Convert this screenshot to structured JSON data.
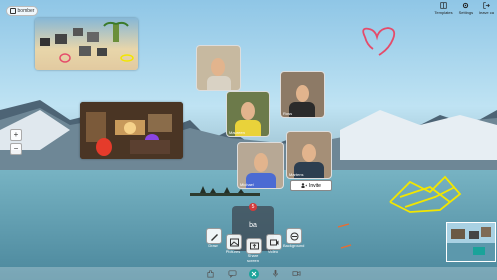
{
  "app": {
    "badge_label": "bomber",
    "badge_icon": "room-icon"
  },
  "toolbar": {
    "items": [
      {
        "label": "Templates",
        "icon": "templates-icon"
      },
      {
        "label": "Settings",
        "icon": "gear-icon"
      },
      {
        "label": "leave ca",
        "icon": "leave-icon"
      }
    ]
  },
  "participants": [
    {
      "name": "",
      "shirt": "#d9d2c4"
    },
    {
      "name": "Maureen",
      "shirt": "#e9d23a"
    },
    {
      "name": "Ross",
      "shirt": "#2b2b2b"
    },
    {
      "name": "Michael",
      "shirt": "#4b6bd3"
    },
    {
      "name": "Martens",
      "shirt": "#2c3e50"
    }
  ],
  "invite": {
    "label": "Invite",
    "icon": "user-plus-icon"
  },
  "zoom": {
    "in": "+",
    "out": "−"
  },
  "dock": {
    "avatar_initials": "ba",
    "badge": "5",
    "tools": [
      {
        "label": "Draw",
        "icon": "pen-icon"
      },
      {
        "label": "Pictures",
        "icon": "image-icon"
      },
      {
        "label": "Share screen",
        "icon": "share-screen-icon"
      },
      {
        "label": "Video",
        "icon": "video-icon"
      },
      {
        "label": "Background",
        "icon": "background-icon"
      }
    ]
  },
  "colors": {
    "annotation_red": "#e54b6a",
    "annotation_yellow": "#f2e600",
    "accent_teal": "#1aa39a"
  }
}
